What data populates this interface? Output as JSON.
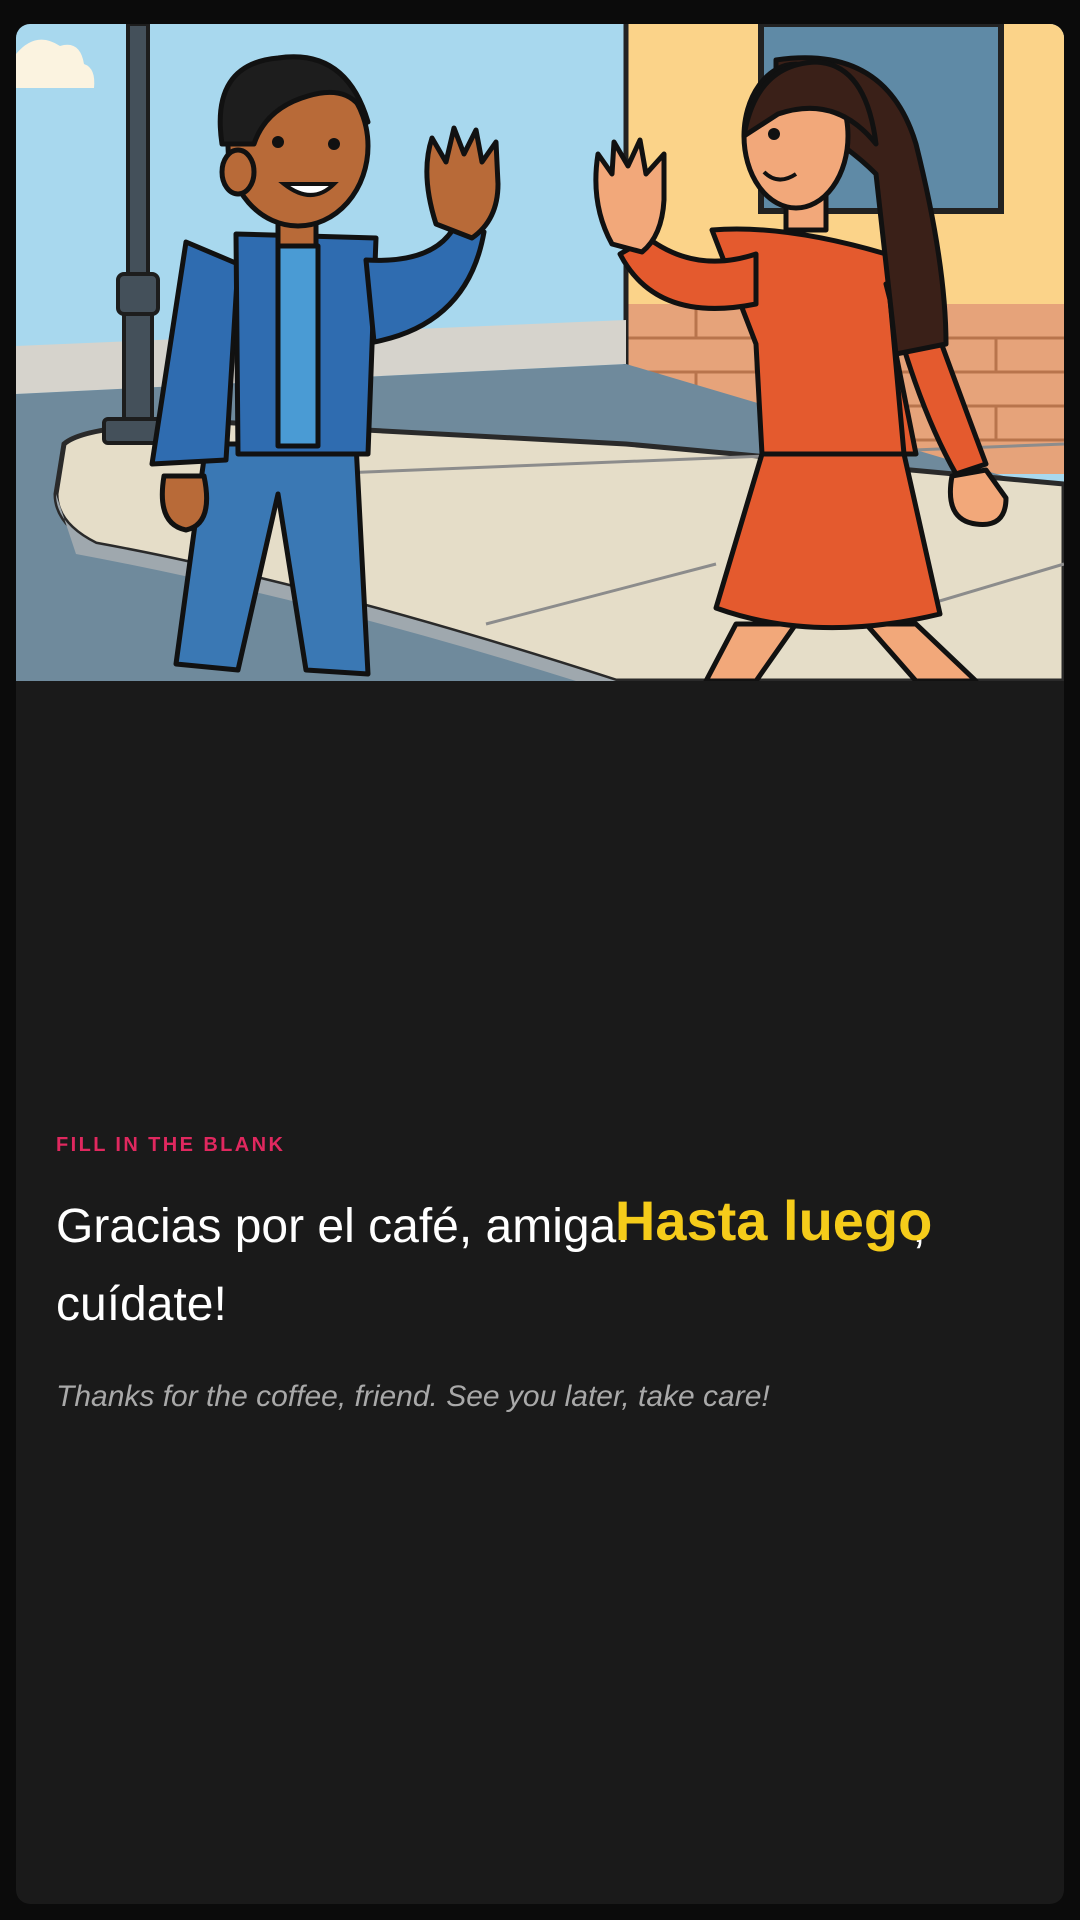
{
  "card": {
    "image_alt": "Two friends waving goodbye on a street corner",
    "colors": {
      "background": "#1a1a1a",
      "label": "#e0285f",
      "sentence": "#ffffff",
      "blank": "#f5cc1a",
      "translation": "#a9a9a9"
    }
  },
  "exercise": {
    "label": "FILL IN THE BLANK",
    "sentence_before": "Gracias por el café, amiga. ",
    "blank_answer": "Hasta luego",
    "sentence_after": ", cuídate!",
    "translation": "Thanks for the coffee, friend. See you later, take care!"
  }
}
